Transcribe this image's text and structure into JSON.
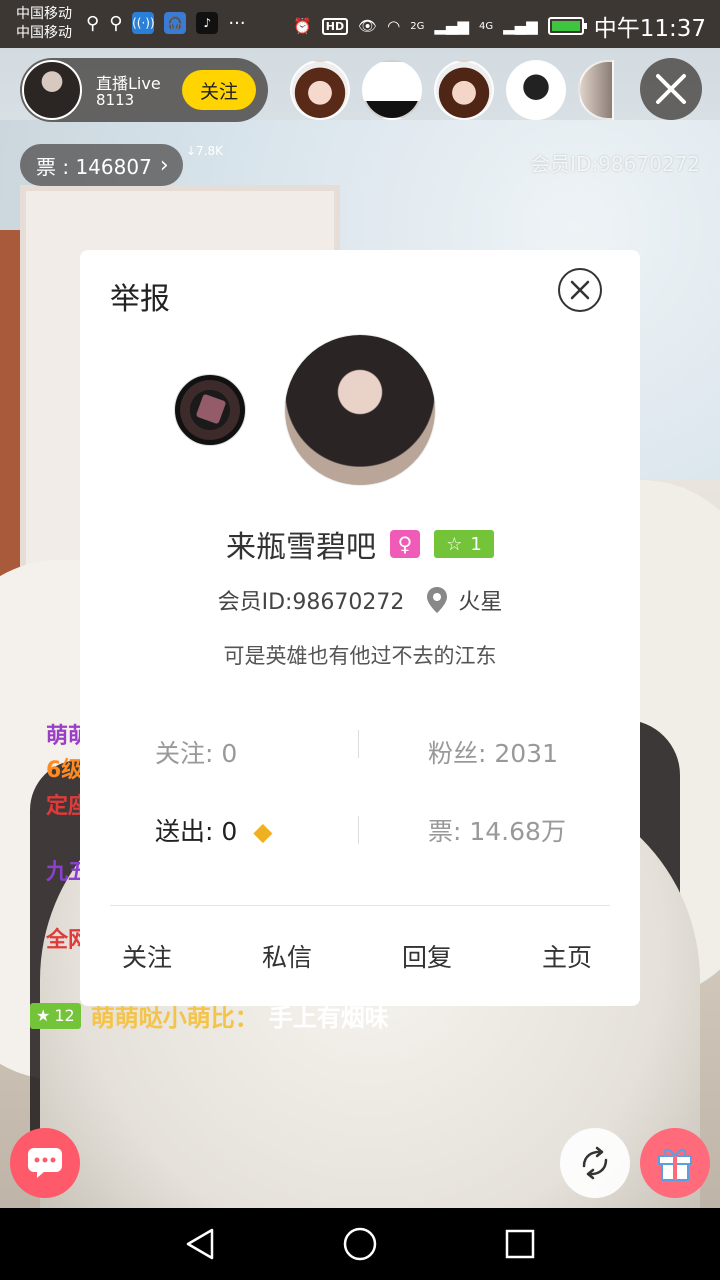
{
  "status_bar": {
    "carrier1": "中国移动",
    "carrier2": "中国移动",
    "hd": "HD",
    "net1": "2G",
    "net2": "4G",
    "time": "中午11:37"
  },
  "streamer": {
    "name": "直播Live",
    "id": "8113",
    "follow_label": "关注"
  },
  "tickets": {
    "label": "票 : 146807",
    "rank": "↓7.8K"
  },
  "member_id_top": "会员ID:98670272",
  "chat": {
    "partial_lines": [
      "萌萌",
      "6级",
      "定座",
      "九五",
      "全网"
    ],
    "line": {
      "level": "12",
      "name": "萌萌哒小萌比：",
      "text": "手上有烟味"
    }
  },
  "dialog": {
    "title": "举报",
    "username": "来瓶雪碧吧",
    "level": "1",
    "member_id": "会员ID:98670272",
    "location": "火星",
    "signature": "可是英雄也有他过不去的江东",
    "stats": {
      "following": "关注: 0",
      "fans": "粉丝: 2031",
      "sent": "送出: 0",
      "tickets": "票: 14.68万"
    },
    "actions": {
      "follow": "关注",
      "message": "私信",
      "reply": "回复",
      "homepage": "主页"
    }
  },
  "colors": {
    "accent_yellow": "#ffd400",
    "level_green": "#74c43a",
    "gender_pink": "#f05bb8",
    "chat_button": "#ff5a6a"
  }
}
